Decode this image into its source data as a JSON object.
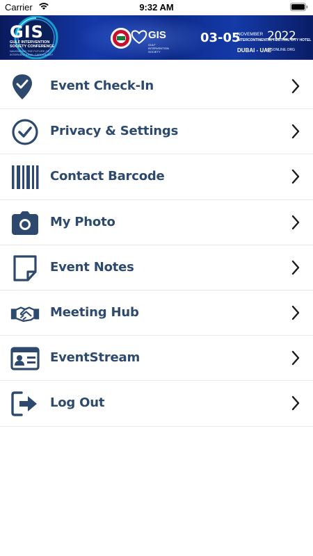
{
  "status_bar": {
    "carrier": "Carrier",
    "time": "9:32 AM"
  },
  "banner": {
    "logo_text": "GIS",
    "logo_subtitle": "GULF INTERVENTION SOCIETY CONFERENCE",
    "logo_tagline": "NAVIGATING THE FUTURE OF INTERVENTIONAL CARDIOLOGY",
    "partner_logo_text": "GIS",
    "partner_logo_subtitle": "GULF INTERVENTION SOCIETY",
    "dates": "03-05",
    "month": "NOVEMBER",
    "year": "2022",
    "venue": "INTERCONTINENTAL FESTIVAL CITY HOTEL",
    "city": "DUBAI - UAE",
    "website": "GISONLINE.ORG"
  },
  "menu": {
    "items": [
      {
        "label": "Event Check-In",
        "icon": "location-check-icon"
      },
      {
        "label": "Privacy & Settings",
        "icon": "check-circle-icon"
      },
      {
        "label": "Contact Barcode",
        "icon": "barcode-icon"
      },
      {
        "label": "My Photo",
        "icon": "camera-icon"
      },
      {
        "label": "Event Notes",
        "icon": "note-icon"
      },
      {
        "label": "Meeting Hub",
        "icon": "handshake-icon"
      },
      {
        "label": "EventStream",
        "icon": "id-card-icon"
      },
      {
        "label": "Log Out",
        "icon": "logout-icon"
      }
    ]
  },
  "colors": {
    "accent": "#2d4a6e",
    "banner": "#1438a8",
    "divider": "#e6e6e6"
  }
}
